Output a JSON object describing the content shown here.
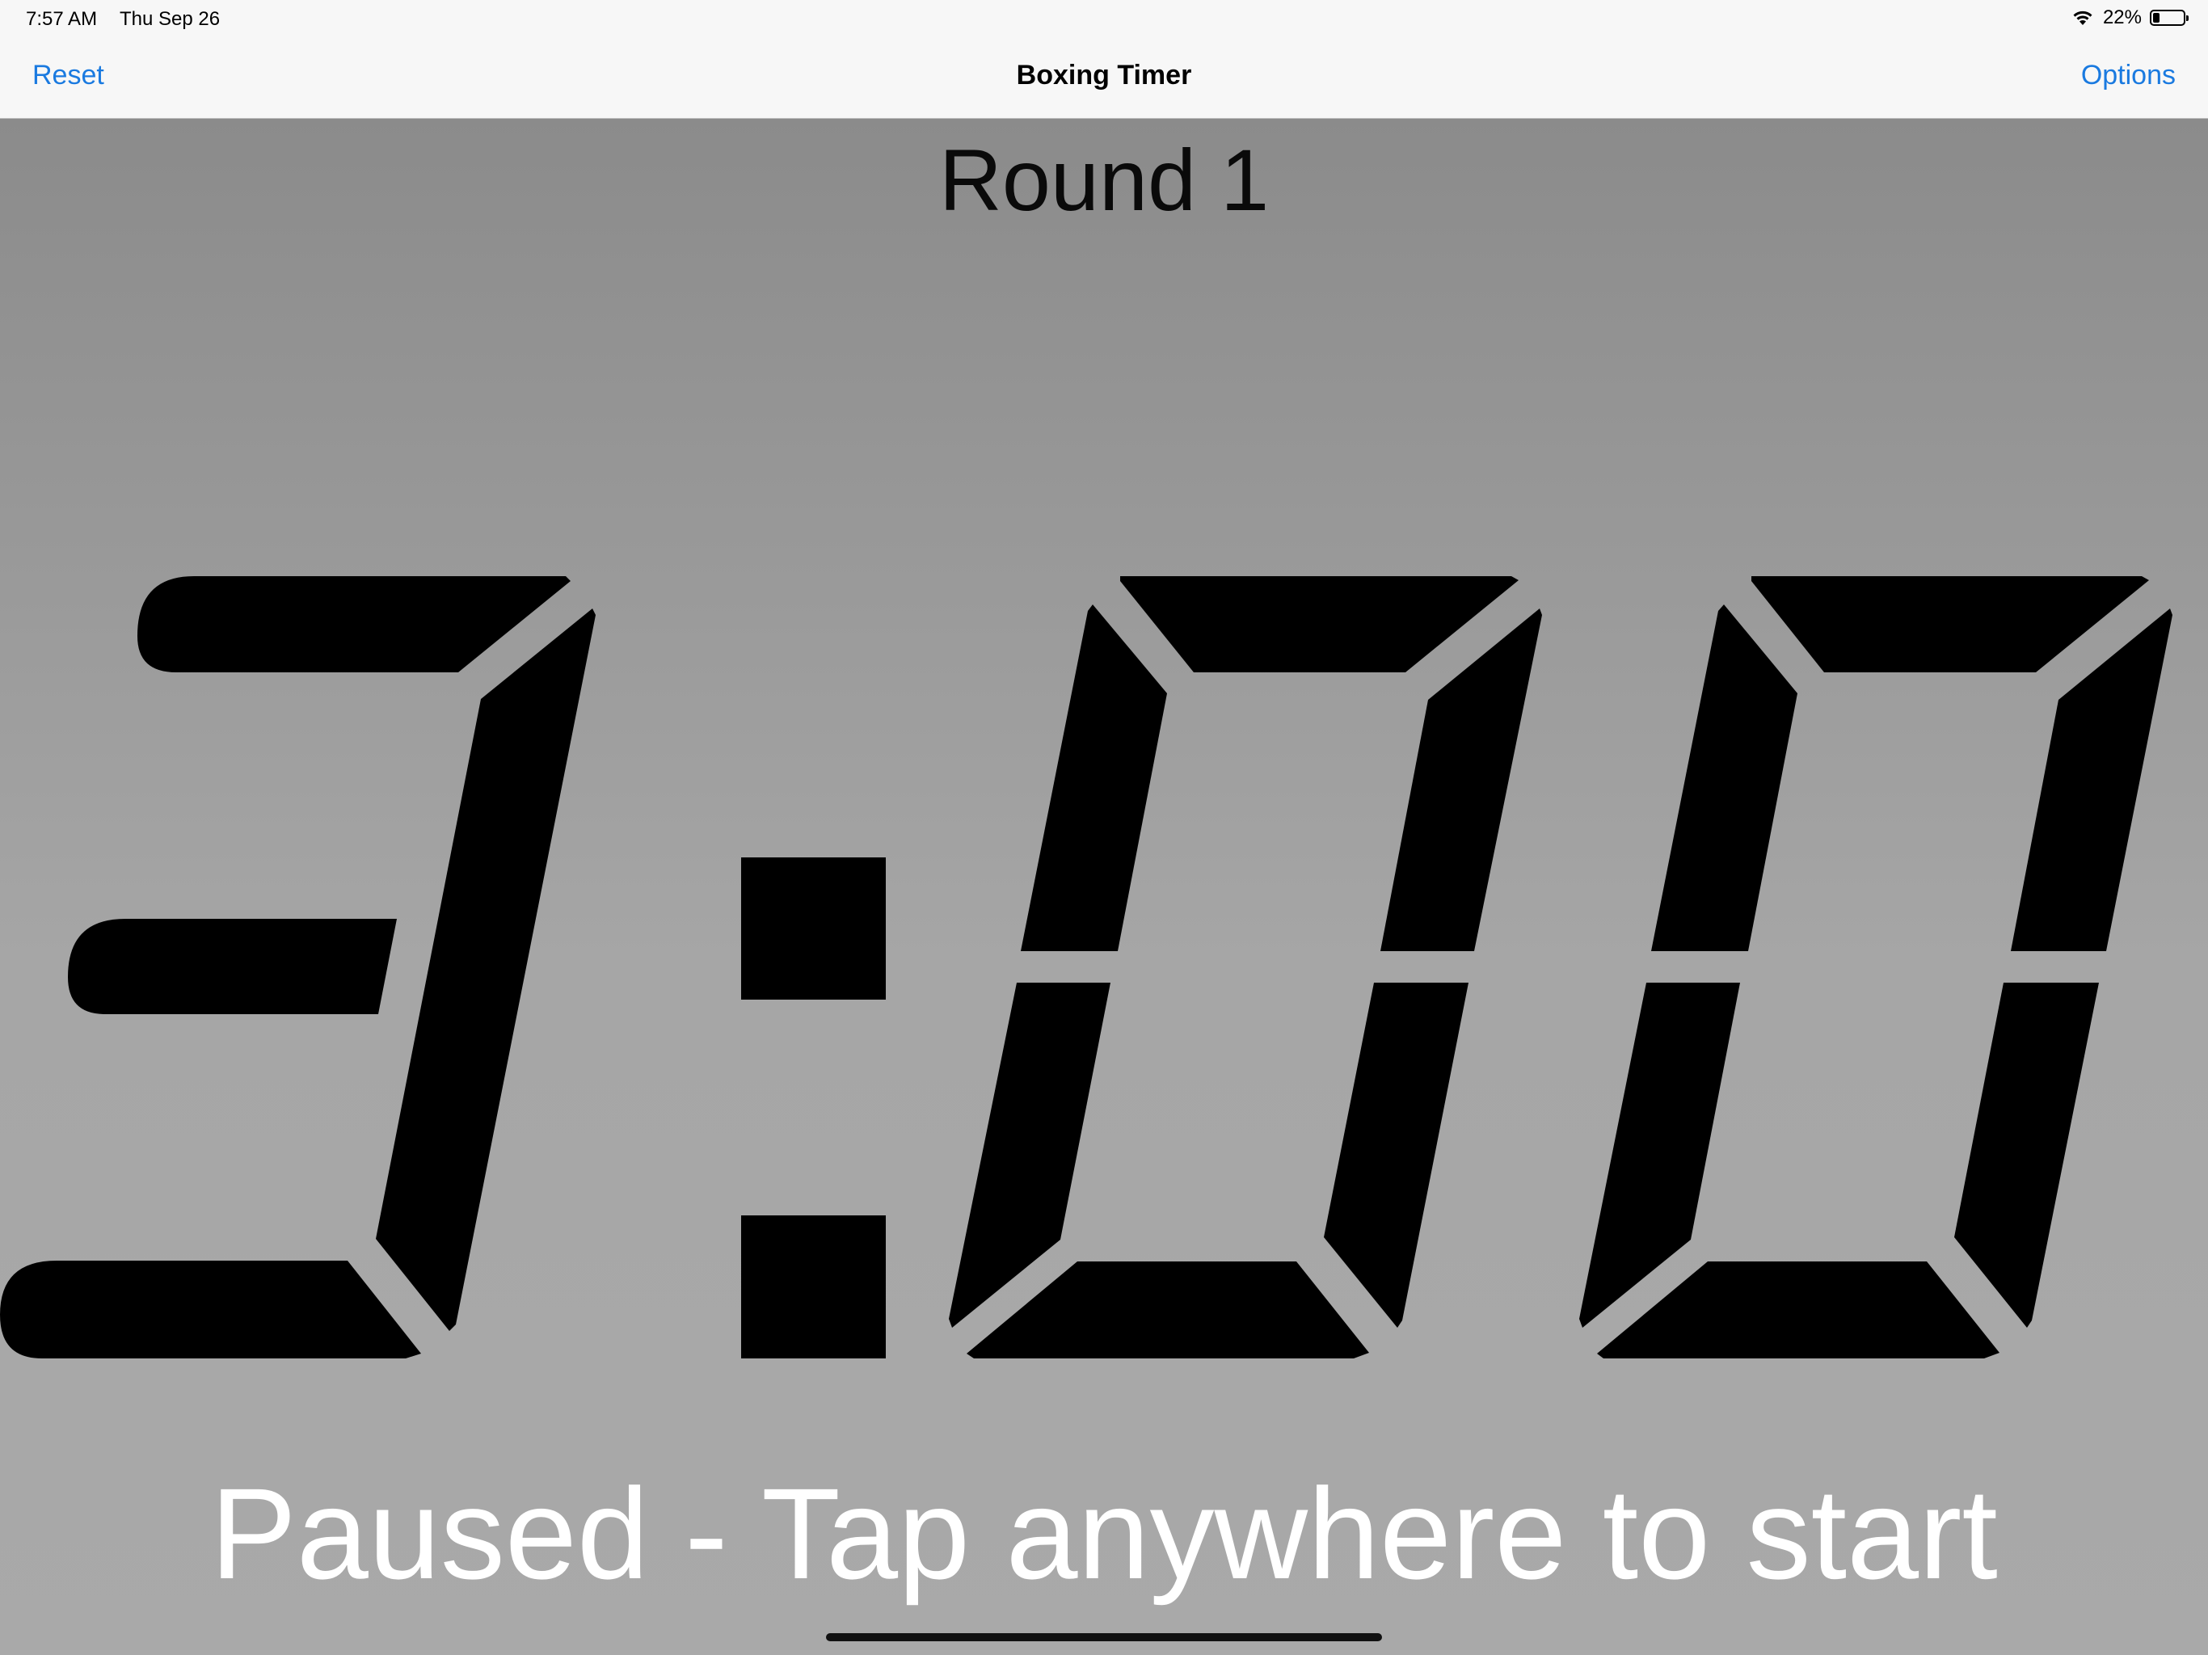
{
  "status_bar": {
    "time": "7:57 AM",
    "date": "Thu Sep 26",
    "battery_percent": "22%",
    "battery_level": 0.22,
    "icons": [
      "wifi-icon",
      "battery-icon"
    ]
  },
  "nav": {
    "left_button": "Reset",
    "title": "Boxing Timer",
    "right_button": "Options",
    "accent_color": "#1a7ae0"
  },
  "timer": {
    "round_label": "Round 1",
    "display": "3:00",
    "status_message": "Paused - Tap anywhere to start",
    "digit_color": "#000000"
  }
}
